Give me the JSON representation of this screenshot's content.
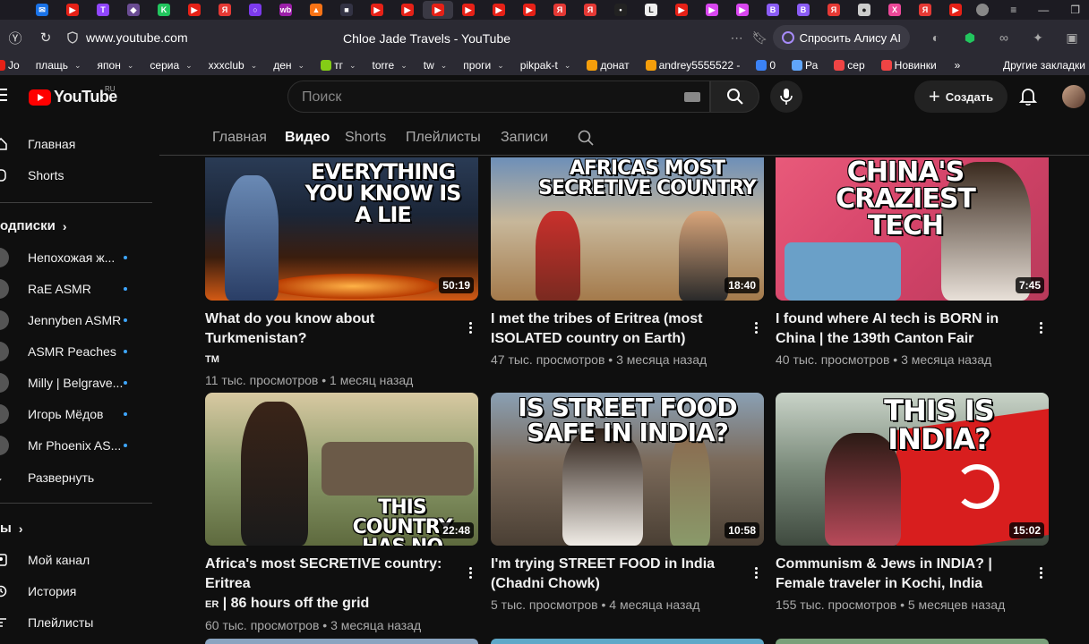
{
  "browser": {
    "url": "www.youtube.com",
    "tab_title": "Chloe Jade Travels - YouTube",
    "alice_label": "Спросить Алису AI",
    "tab_favicons": [
      {
        "icon": "mail-icon",
        "color": "#1a73e8",
        "glyph": "✉"
      },
      {
        "icon": "youtube-icon",
        "color": "#e62117",
        "glyph": "▶"
      },
      {
        "icon": "twitch-icon",
        "color": "#9146ff",
        "glyph": "T"
      },
      {
        "icon": "app-icon",
        "color": "#6a4c93",
        "glyph": "◆"
      },
      {
        "icon": "k-icon",
        "color": "#22c55e",
        "glyph": "K"
      },
      {
        "icon": "youtube-icon",
        "color": "#e62117",
        "glyph": "▶"
      },
      {
        "icon": "yandex-icon",
        "color": "#e53935",
        "glyph": "Я"
      },
      {
        "icon": "ring-icon",
        "color": "#7c3aed",
        "glyph": "○"
      },
      {
        "icon": "wb-icon",
        "color": "#9b1fa8",
        "glyph": "wb"
      },
      {
        "icon": "fire-icon",
        "color": "#f97316",
        "glyph": "▲"
      },
      {
        "icon": "game-icon",
        "color": "#333344",
        "glyph": "■"
      },
      {
        "icon": "youtube-icon",
        "color": "#e62117",
        "glyph": "▶"
      },
      {
        "icon": "youtube-icon",
        "color": "#e62117",
        "glyph": "▶"
      },
      {
        "icon": "youtube-icon",
        "color": "#e62117",
        "glyph": "▶"
      },
      {
        "icon": "youtube-icon",
        "color": "#e62117",
        "glyph": "▶"
      },
      {
        "icon": "youtube-icon",
        "color": "#e62117",
        "glyph": "▶"
      },
      {
        "icon": "youtube-icon",
        "color": "#e62117",
        "glyph": "▶"
      },
      {
        "icon": "yandex-icon",
        "color": "#e53935",
        "glyph": "Я"
      },
      {
        "icon": "yandex-icon",
        "color": "#e53935",
        "glyph": "Я"
      },
      {
        "icon": "dots-icon",
        "color": "#222222",
        "glyph": "•"
      },
      {
        "icon": "letter-icon",
        "color": "#eeeeee",
        "glyph": "L"
      },
      {
        "icon": "youtube-icon",
        "color": "#e62117",
        "glyph": "▶"
      },
      {
        "icon": "play-icon",
        "color": "#d946ef",
        "glyph": "▶"
      },
      {
        "icon": "play-icon",
        "color": "#d946ef",
        "glyph": "▶"
      },
      {
        "icon": "b-icon",
        "color": "#8b5cf6",
        "glyph": "B"
      },
      {
        "icon": "b-icon",
        "color": "#8b5cf6",
        "glyph": "B"
      },
      {
        "icon": "yandex-icon",
        "color": "#e53935",
        "glyph": "Я"
      },
      {
        "icon": "cat-icon",
        "color": "#cccccc",
        "glyph": "●"
      },
      {
        "icon": "x-icon",
        "color": "#ec4899",
        "glyph": "X"
      },
      {
        "icon": "yandex-icon",
        "color": "#e53935",
        "glyph": "Я"
      },
      {
        "icon": "youtube-icon",
        "color": "#e62117",
        "glyph": "▶"
      }
    ],
    "bookmarks": [
      {
        "label": "Jo",
        "icon": "youtube-icon",
        "color": "#e62117",
        "dropdown": false
      },
      {
        "label": "плащь",
        "dropdown": true
      },
      {
        "label": "япон",
        "dropdown": true
      },
      {
        "label": "сериа",
        "dropdown": true
      },
      {
        "label": "xxxclub",
        "dropdown": true
      },
      {
        "label": "ден",
        "dropdown": true
      },
      {
        "label": "тг",
        "icon": "crown-icon",
        "color": "#84cc16",
        "dropdown": true
      },
      {
        "label": "torre",
        "dropdown": true
      },
      {
        "label": "tw",
        "dropdown": true
      },
      {
        "label": "проги",
        "dropdown": true
      },
      {
        "label": "pikpak-t",
        "dropdown": true
      },
      {
        "label": "донат",
        "icon": "d-icon",
        "color": "#f59e0b",
        "dropdown": false
      },
      {
        "label": "andrey5555522 -",
        "icon": "d-icon",
        "color": "#f59e0b",
        "dropdown": false
      },
      {
        "label": "0",
        "icon": "mail-icon",
        "color": "#3b82f6",
        "dropdown": false
      },
      {
        "label": "Ра",
        "icon": "circle-icon",
        "color": "#60a5fa",
        "dropdown": false
      },
      {
        "label": "сер",
        "icon": "flame-icon",
        "color": "#ef4444",
        "dropdown": false
      },
      {
        "label": "Новинки",
        "icon": "k-icon",
        "color": "#ef4444",
        "dropdown": false
      }
    ],
    "bookmarks_more": "»",
    "bookmarks_other": "Другие закладки"
  },
  "youtube": {
    "logo_text": "YouTube",
    "logo_region": "RU",
    "search_placeholder": "Поиск",
    "create_label": "Создать"
  },
  "sidebar": {
    "home": "Главная",
    "shorts": "Shorts",
    "subscriptions_title": "одписки",
    "subscriptions": [
      "Непохожая ж...",
      "RaE ASMR",
      "Jennyben ASMR",
      "ASMR Peaches",
      "Milly | Belgrave...",
      "Игорь Мёдов",
      "Mr Phoenix AS..."
    ],
    "expand": "Развернуть",
    "you_title": "ы",
    "my_channel": "Мой канал",
    "history": "История",
    "playlists": "Плейлисты"
  },
  "channel_tabs": [
    "Главная",
    "Видео",
    "Shorts",
    "Плейлисты",
    "Записи"
  ],
  "videos": [
    {
      "title": "What do you know about Turkmenistan?",
      "flag": "TM",
      "meta": "11 тыс. просмотров • 1 месяц назад",
      "duration": "50:19",
      "thumb_text": "EVERYTHING YOU KNOW IS A LIE"
    },
    {
      "title": "I met the tribes of Eritrea (most ISOLATED country on Earth)",
      "meta": "47 тыс. просмотров • 3 месяца назад",
      "duration": "18:40",
      "thumb_text": "AFRICAS MOST SECRETIVE COUNTRY"
    },
    {
      "title": "I found where AI tech is BORN in China | the 139th Canton Fair",
      "meta": "40 тыс. просмотров • 3 месяца назад",
      "duration": "7:45",
      "thumb_text": "CHINA'S CRAZIEST TECH"
    },
    {
      "title": "Africa's most SECRETIVE country: Eritrea",
      "flag": "ER",
      "title_tail": "| 86 hours off the grid",
      "meta": "60 тыс. просмотров • 3 месяца назад",
      "duration": "22:48",
      "thumb_text": "THIS COUNTRY HAS NO INTERNET"
    },
    {
      "title": "I'm trying STREET FOOD in India (Chadni Chowk)",
      "meta": "5 тыс. просмотров • 4 месяца назад",
      "duration": "10:58",
      "thumb_text": "IS STREET FOOD SAFE IN INDIA?"
    },
    {
      "title": "Communism & Jews in INDIA? | Female traveler in Kochi, India",
      "meta": "155 тыс. просмотров • 5 месяцев назад",
      "duration": "15:02",
      "thumb_text": "THIS IS INDIA?"
    }
  ]
}
